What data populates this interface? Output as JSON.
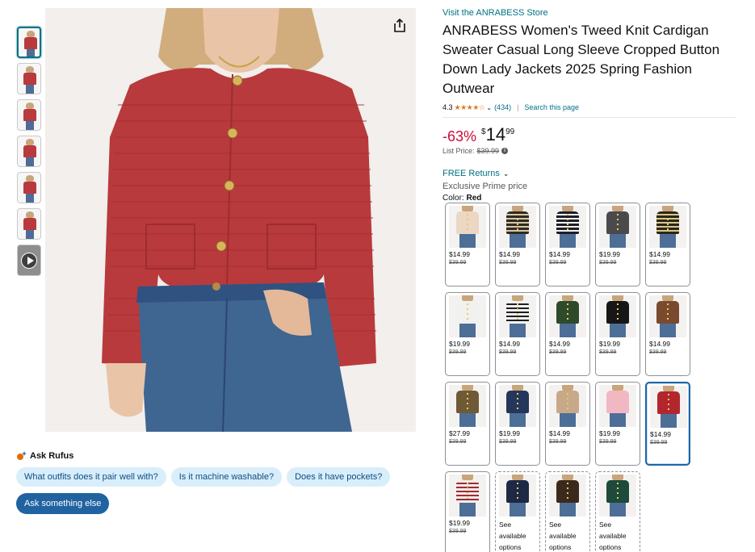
{
  "thumbnails": [
    {
      "name": "thumb-1",
      "color": "#b93a3e"
    },
    {
      "name": "thumb-2",
      "color": "#b93a3e"
    },
    {
      "name": "thumb-3",
      "color": "#b93a3e"
    },
    {
      "name": "thumb-4",
      "color": "#b93a3e"
    },
    {
      "name": "thumb-5",
      "color": "#b93a3e"
    },
    {
      "name": "thumb-6",
      "color": "#b93a3e"
    },
    {
      "name": "thumb-video",
      "color": "#8e8e8e"
    }
  ],
  "product": {
    "store_link": "Visit the ANRABESS Store",
    "title": "ANRABESS Women's Tweed Knit Cardigan Sweater Casual Long Sleeve Cropped Button Down Lady Jackets 2025 Spring Fashion Outwear",
    "rating": "4.3",
    "stars": "★★★★☆",
    "review_count": "(434)",
    "search_page": "Search this page",
    "discount": "-63%",
    "currency": "$",
    "price_whole": "14",
    "price_fraction": "99",
    "list_price_label": "List Price:",
    "list_price": "$39.99",
    "returns": "FREE Returns",
    "prime_text": "Exclusive Prime price",
    "color_label": "Color:",
    "color_value": "Red"
  },
  "rufus": {
    "title": "Ask Rufus",
    "chips": [
      "What outfits does it pair well with?",
      "Is it machine washable?",
      "Does it have pockets?"
    ],
    "ask_button": "Ask something else"
  },
  "swatches": [
    {
      "color": "#ecd7c4",
      "price": "$14.99",
      "old": "$39.99"
    },
    {
      "color": "#2f2a23",
      "stripes": "#d6c9a6",
      "price": "$14.99",
      "old": "$39.99"
    },
    {
      "color": "#1e1e26",
      "stripes": "#f2f2f2",
      "price": "$14.99",
      "old": "$39.99"
    },
    {
      "color": "#4a4a4d",
      "price": "$19.99",
      "old": "$39.99"
    },
    {
      "color": "#2b2618",
      "stripes": "#d9c88e",
      "price": "$14.99",
      "old": "$39.99"
    },
    {
      "color": "#f1f1ef",
      "price": "$19.99",
      "old": "$39.99"
    },
    {
      "color": "#f2f2f2",
      "stripes": "#1f1f1f",
      "price": "$14.99",
      "old": "$39.99"
    },
    {
      "color": "#2f4a2a",
      "price": "$14.99",
      "old": "$39.99"
    },
    {
      "color": "#161616",
      "price": "$19.99",
      "old": "$39.99"
    },
    {
      "color": "#7a4a2e",
      "price": "$14.99",
      "old": "$39.99"
    },
    {
      "color": "#6f5a36",
      "price": "$27.99",
      "old": "$39.99"
    },
    {
      "color": "#25365a",
      "price": "$19.99",
      "old": "$39.99"
    },
    {
      "color": "#c7a98a",
      "price": "$14.99",
      "old": "$39.99"
    },
    {
      "color": "#f2b7c4",
      "price": "$19.99",
      "old": "$39.99"
    },
    {
      "color": "#b3262e",
      "price": "$14.99",
      "old": "$39.99",
      "selected": true
    },
    {
      "color": "#f1ecea",
      "stripes": "#a32b35",
      "price": "$19.99",
      "old": "$39.99"
    },
    {
      "color": "#1d2844",
      "see": "See available options",
      "unavailable": true
    },
    {
      "color": "#3b2a1c",
      "see": "See available options",
      "unavailable": true
    },
    {
      "color": "#1d4a3a",
      "see": "See available options",
      "unavailable": true
    }
  ]
}
